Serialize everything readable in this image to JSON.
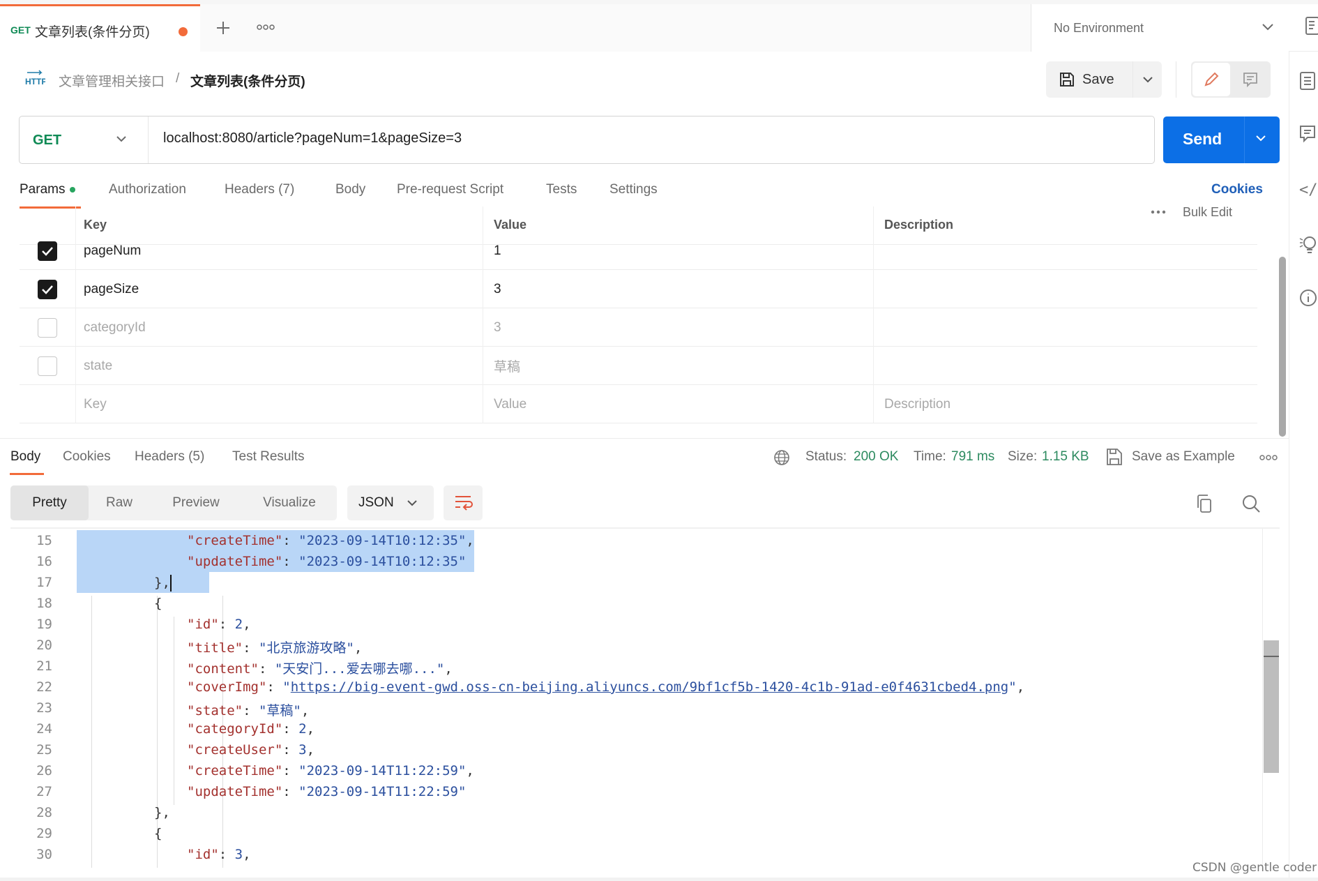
{
  "tab": {
    "method": "GET",
    "name": "文章列表(条件分页)",
    "unsaved": true,
    "new_tab_icon": "plus-icon",
    "more_icon": "ellipsis-icon"
  },
  "environment": {
    "selected": "No Environment"
  },
  "breadcrumb": {
    "protocol_icon": "HTTP",
    "parent": "文章管理相关接口",
    "separator": "/",
    "current": "文章列表(条件分页)"
  },
  "toolbar": {
    "save_label": "Save"
  },
  "request": {
    "method": "GET",
    "url": "localhost:8080/article?pageNum=1&pageSize=3",
    "send_label": "Send"
  },
  "request_tabs": [
    {
      "label": "Params",
      "active": true,
      "dot": true
    },
    {
      "label": "Authorization"
    },
    {
      "label": "Headers (7)"
    },
    {
      "label": "Body"
    },
    {
      "label": "Pre-request Script"
    },
    {
      "label": "Tests"
    },
    {
      "label": "Settings"
    }
  ],
  "cookies_link": "Cookies",
  "params": {
    "headers": {
      "key": "Key",
      "value": "Value",
      "description": "Description"
    },
    "bulk_edit": "Bulk Edit",
    "rows": [
      {
        "checked": true,
        "key": "pageNum",
        "value": "1",
        "description": ""
      },
      {
        "checked": true,
        "key": "pageSize",
        "value": "3",
        "description": ""
      },
      {
        "checked": false,
        "key": "categoryId",
        "value": "3",
        "description": ""
      },
      {
        "checked": false,
        "key": "state",
        "value": "草稿",
        "description": ""
      }
    ],
    "placeholder": {
      "key": "Key",
      "value": "Value",
      "description": "Description"
    }
  },
  "response": {
    "tabs": [
      {
        "label": "Body",
        "active": true
      },
      {
        "label": "Cookies"
      },
      {
        "label": "Headers (5)"
      },
      {
        "label": "Test Results"
      }
    ],
    "status_label": "Status:",
    "status_value": "200 OK",
    "time_label": "Time:",
    "time_value": "791 ms",
    "size_label": "Size:",
    "size_value": "1.15 KB",
    "save_example": "Save as Example",
    "formats": [
      "Pretty",
      "Raw",
      "Preview",
      "Visualize"
    ],
    "active_format": "Pretty",
    "language": "JSON"
  },
  "code_lines": [
    {
      "n": "15",
      "indent": 4,
      "key": "createTime",
      "str": "2023-09-14T10:12:35",
      "trail": ",",
      "selected": true
    },
    {
      "n": "16",
      "indent": 4,
      "key": "updateTime",
      "str": "2023-09-14T10:12:35",
      "trail": "",
      "selected": true
    },
    {
      "n": "17",
      "indent": 3,
      "raw": "},",
      "selected": true,
      "caret": true
    },
    {
      "n": "18",
      "indent": 3,
      "raw": "{"
    },
    {
      "n": "19",
      "indent": 4,
      "key": "id",
      "num": "2",
      "trail": ","
    },
    {
      "n": "20",
      "indent": 4,
      "key": "title",
      "str": "北京旅游攻略",
      "trail": ","
    },
    {
      "n": "21",
      "indent": 4,
      "key": "content",
      "str": "天安门...爱去哪去哪...",
      "trail": ","
    },
    {
      "n": "22",
      "indent": 4,
      "key": "coverImg",
      "url": "https://big-event-gwd.oss-cn-beijing.aliyuncs.com/9bf1cf5b-1420-4c1b-91ad-e0f4631cbed4.png",
      "trail": ","
    },
    {
      "n": "23",
      "indent": 4,
      "key": "state",
      "str": "草稿",
      "trail": ","
    },
    {
      "n": "24",
      "indent": 4,
      "key": "categoryId",
      "num": "2",
      "trail": ","
    },
    {
      "n": "25",
      "indent": 4,
      "key": "createUser",
      "num": "3",
      "trail": ","
    },
    {
      "n": "26",
      "indent": 4,
      "key": "createTime",
      "str": "2023-09-14T11:22:59",
      "trail": ","
    },
    {
      "n": "27",
      "indent": 4,
      "key": "updateTime",
      "str": "2023-09-14T11:22:59",
      "trail": ""
    },
    {
      "n": "28",
      "indent": 3,
      "raw": "},"
    },
    {
      "n": "29",
      "indent": 3,
      "raw": "{"
    },
    {
      "n": "30",
      "indent": 4,
      "key": "id",
      "num": "3",
      "trail": ","
    }
  ],
  "watermark": "CSDN @gentle coder",
  "colors": {
    "accent": "#f26b3a",
    "send": "#0c6fe6",
    "method_get": "#0f8a55",
    "status_ok": "#2c8a5f",
    "json_key": "#a3312e",
    "json_value": "#2b4f9e",
    "selection": "#b9d6f7"
  }
}
